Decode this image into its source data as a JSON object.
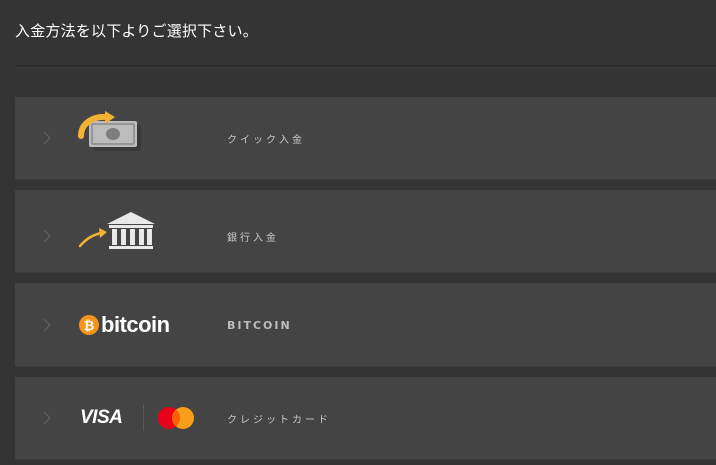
{
  "header": {
    "title": "入金方法を以下よりご選択下さい。"
  },
  "methods": [
    {
      "label": "クイック入金",
      "icon": "quick-deposit-icon"
    },
    {
      "label": "銀行入金",
      "icon": "bank-icon"
    },
    {
      "label": "BITCOIN",
      "icon": "bitcoin-logo",
      "logo_text": "bitcoin",
      "logo_symbol": "₿"
    },
    {
      "label": "クレジットカード",
      "icon": "visa-mastercard-logos",
      "logo_text": "VISA"
    }
  ],
  "colors": {
    "background": "#343434",
    "row": "#444444",
    "accent_orange": "#f7931a",
    "arrow_yellow": "#f2b233",
    "mastercard_red": "#eb001b",
    "mastercard_yellow": "#f79e1b"
  }
}
